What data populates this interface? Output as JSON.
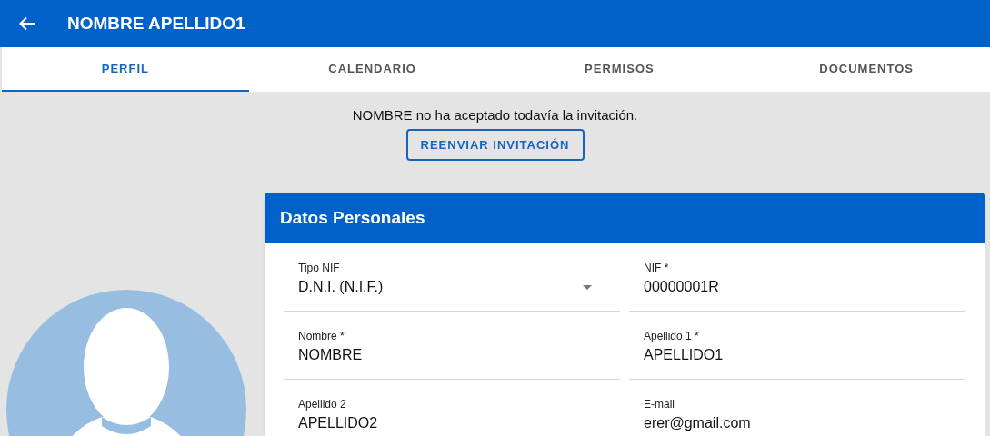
{
  "header": {
    "title": "NOMBRE APELLIDO1"
  },
  "tabs": [
    {
      "label": "PERFIL",
      "selected": true
    },
    {
      "label": "CALENDARIO",
      "selected": false
    },
    {
      "label": "PERMISOS",
      "selected": false
    },
    {
      "label": "DOCUMENTOS",
      "selected": false
    }
  ],
  "notice": {
    "message": "NOMBRE no ha aceptado todavía la invitación.",
    "button": "REENVIAR INVITACIÓN"
  },
  "card": {
    "title": "Datos Personales",
    "fields": [
      {
        "kind": "select",
        "label": "Tipo NIF",
        "value": "D.N.I. (N.I.F.)"
      },
      {
        "kind": "text",
        "label": "NIF *",
        "value": "00000001R"
      },
      {
        "kind": "text",
        "label": "Nombre *",
        "value": "NOMBRE"
      },
      {
        "kind": "text",
        "label": "Apellido 1 *",
        "value": "APELLIDO1"
      },
      {
        "kind": "text",
        "label": "Apellido 2",
        "value": "APELLIDO2"
      },
      {
        "kind": "text",
        "label": "E-mail",
        "value": "erer@gmail.com"
      }
    ]
  }
}
